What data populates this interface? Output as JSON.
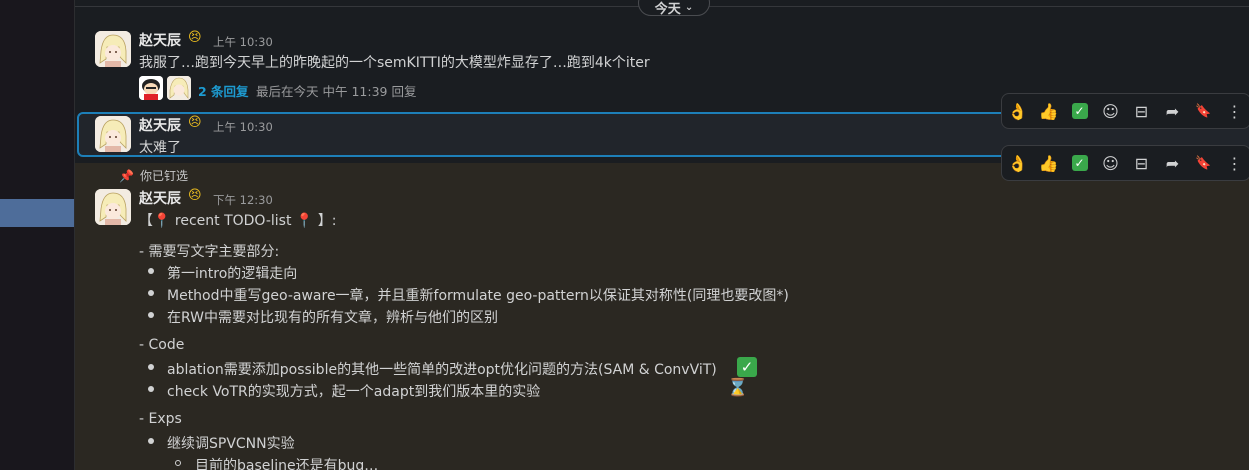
{
  "date_divider": {
    "label": "今天",
    "chevron": "chevron-down-icon"
  },
  "messages": [
    {
      "author": "赵天辰",
      "status_emoji": "persevering-face",
      "time": "上午 10:30",
      "text": "我服了…跑到今天早上的昨晚起的一个semKITTI的大模型炸显存了…跑到4k个iter",
      "thread": {
        "reply_count": "2 条回复",
        "last_reply": "最后在今天 中午 11:39 回复"
      }
    },
    {
      "author": "赵天辰",
      "status_emoji": "persevering-face",
      "time": "上午 10:30",
      "text": "太难了"
    },
    {
      "pinned_note": "你已钉选",
      "author": "赵天辰",
      "status_emoji": "persevering-face",
      "time": "下午 12:30",
      "title_left": "【",
      "title_mid": " recent TODO-list ",
      "title_right": " 】:",
      "sections": {
        "s1_heading": "- 需要写文字主要部分:",
        "s1_items": [
          "第一intro的逻辑走向",
          "Method中重写geo-aware一章，并且重新formulate geo-pattern以保证其对称性(同理也要改图*)",
          "在RW中需要对比现有的所有文章，辨析与他们的区别"
        ],
        "s2_heading": "- Code",
        "s2_items": [
          "ablation需要添加possible的其他一些简单的改进opt优化问题的方法(SAM & ConvViT)",
          "check VoTR的实现方式，起一个adapt到我们版本里的实验"
        ],
        "s3_heading": "- Exps",
        "s3_items": [
          "继续调SPVCNN实验"
        ],
        "s3_sub_items": [
          "目前的baseline还是有bug…"
        ]
      }
    }
  ],
  "toolbar_icons": [
    "ok-hand-icon",
    "thumbs-up-icon",
    "check-mark-icon",
    "add-reaction-icon",
    "reply-thread-icon",
    "forward-icon",
    "bookmark-icon",
    "more-icon"
  ],
  "toolbar_glyphs": {
    "ok": "👌",
    "thumbs": "👍",
    "check": "✓",
    "add_reaction": "☺",
    "thread": "⊟",
    "forward": "➦",
    "bookmark": "🔖",
    "more": "⋮"
  },
  "colors": {
    "link": "#1d9bd1",
    "pinned_bg": "#2b2822",
    "highlight_border": "#1d7fb8",
    "sidebar_active": "#4e6d9a"
  }
}
